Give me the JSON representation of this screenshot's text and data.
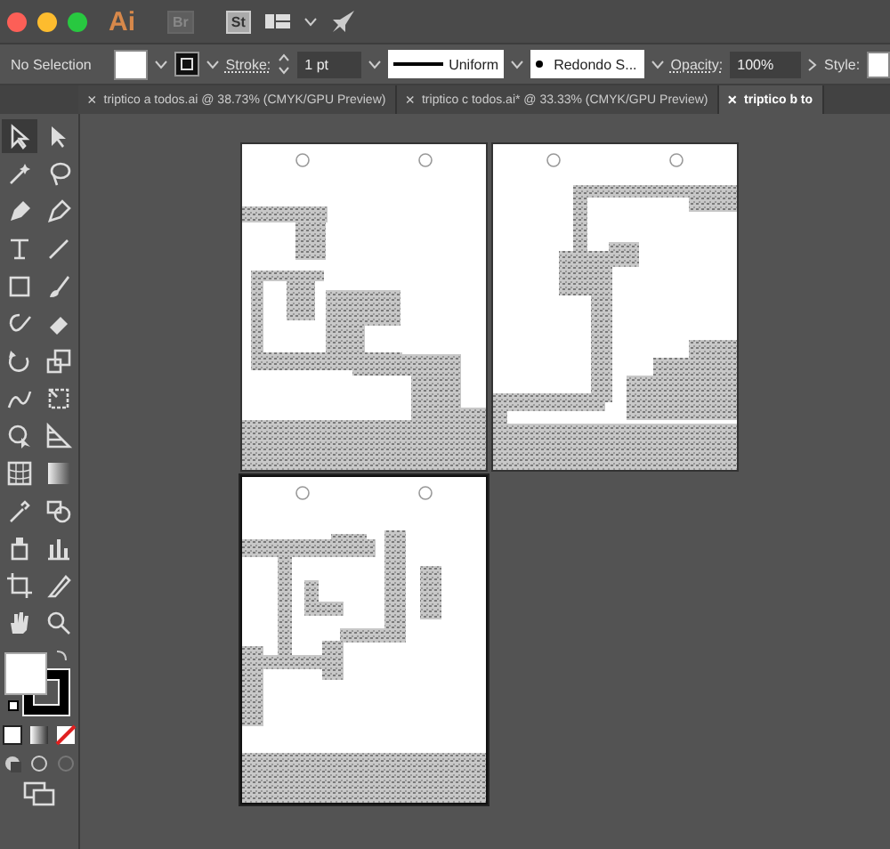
{
  "title_bar": {
    "window_controls": [
      {
        "color": "#fc5f57"
      },
      {
        "color": "#fdbc2e"
      },
      {
        "color": "#28c840"
      }
    ],
    "app_logo": "Ai",
    "bridge": "Br",
    "stock": "St"
  },
  "control_bar": {
    "selection": "No Selection",
    "stroke_label": "Stroke:",
    "stroke_weight": "1 pt",
    "stroke_profile": "Uniform",
    "brush": "Redondo S...",
    "opacity_label": "Opacity:",
    "opacity": "100%",
    "style_label": "Style:"
  },
  "tabs": [
    {
      "close": "×",
      "label": "triptico a todos.ai @ 38.73% (CMYK/GPU Preview)",
      "selected": false
    },
    {
      "close": "×",
      "label": "triptico c todos.ai* @ 33.33% (CMYK/GPU Preview)",
      "selected": false
    },
    {
      "close": "×",
      "label": "triptico b to",
      "selected": true
    }
  ]
}
